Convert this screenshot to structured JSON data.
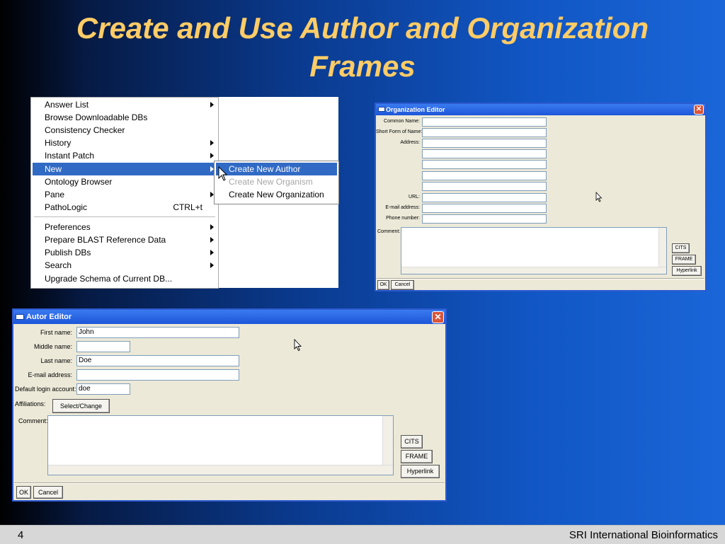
{
  "slide": {
    "title_line1": "Create and Use Author and Organization",
    "title_line2": "Frames",
    "page_number": "4",
    "footer_org": "SRI International Bioinformatics"
  },
  "menu": {
    "items": [
      {
        "label": "Answer List",
        "submenu": true
      },
      {
        "label": "Browse Downloadable DBs"
      },
      {
        "label": "Consistency Checker"
      },
      {
        "label": "History",
        "submenu": true
      },
      {
        "label": "Instant Patch",
        "submenu": true
      },
      {
        "label": "New",
        "submenu": true,
        "selected": true
      },
      {
        "label": "Ontology Browser"
      },
      {
        "label": "Pane",
        "submenu": true
      },
      {
        "label": "PathoLogic",
        "accelerator": "CTRL+t"
      },
      {
        "label": "Preferences",
        "submenu": true
      },
      {
        "label": "Prepare BLAST Reference Data",
        "submenu": true
      },
      {
        "label": "Publish DBs",
        "submenu": true
      },
      {
        "label": "Search",
        "submenu": true
      },
      {
        "label": "Upgrade Schema of Current DB..."
      }
    ],
    "submenu": [
      {
        "label": "Create New Author",
        "selected": true
      },
      {
        "label": "Create New Organism",
        "disabled": true
      },
      {
        "label": "Create New Organization"
      }
    ]
  },
  "org_editor": {
    "title": "Organization Editor",
    "common_name_label": "Common Name:",
    "short_form_label": "Short Form of Name:",
    "address_label": "Address:",
    "url_label": "URL:",
    "email_label": "E-mail address:",
    "phone_label": "Phone number:",
    "comment_label": "Comment:",
    "cits_button": "CITS",
    "frame_button": "FRAME",
    "hyperlink_button": "Hyperlink",
    "ok_button": "OK",
    "cancel_button": "Cancel"
  },
  "author_editor": {
    "title": "Autor Editor",
    "first_name_label": "First name:",
    "first_name_value": "John",
    "middle_name_label": "Middle name:",
    "middle_name_value": "",
    "last_name_label": "Last name:",
    "last_name_value": "Doe",
    "email_label": "E-mail address:",
    "email_value": "",
    "login_label": "Default login account:",
    "login_value": "doe",
    "affiliations_label": "Affiliations:",
    "select_change_button": "Select/Change",
    "comment_label": "Comment:",
    "cits_button": "CITS",
    "frame_button": "FRAME",
    "hyperlink_button": "Hyperlink",
    "ok_button": "OK",
    "cancel_button": "Cancel"
  },
  "colors": {
    "title": "#ffcc66",
    "menu_selection": "#316ac5",
    "window_titlebar": "#1d55d8",
    "window_body": "#ece9d8"
  }
}
